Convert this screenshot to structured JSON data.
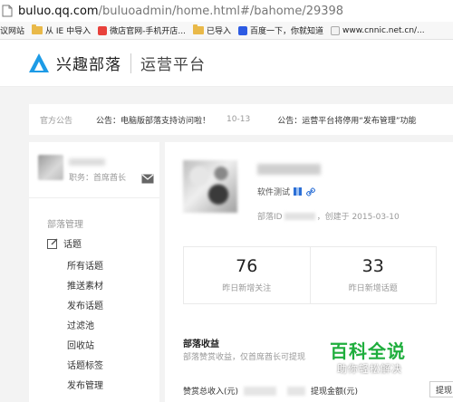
{
  "browser": {
    "url_host": "buluo.qq.com",
    "url_path": "/buluoadmin/home.html#/bahome/29398",
    "bookmarks": [
      {
        "label": "议网站",
        "icon": "none"
      },
      {
        "label": "从 IE 中导入",
        "icon": "folder-icon"
      },
      {
        "label": "微店官网-手机开店...",
        "icon": "weidian-icon"
      },
      {
        "label": "已导入",
        "icon": "folder-icon"
      },
      {
        "label": "百度一下，你就知道",
        "icon": "baidu-icon"
      },
      {
        "label": "www.cnnic.net.cn/...",
        "icon": "cnnic-icon"
      }
    ]
  },
  "header": {
    "brand": "兴趣部落",
    "platform": "运营平台"
  },
  "notice": {
    "label": "官方公告",
    "item1": "公告：电脑版部落支持访问啦！",
    "date1": "10-13",
    "item2": "公告：运营平台将停用“发布管理”功能"
  },
  "sidebar": {
    "role": "职务：首席酋长",
    "group_label": "部落管理",
    "topic_label": "话题",
    "sub_items": [
      "所有话题",
      "推送素材",
      "发布话题",
      "过滤池",
      "回收站",
      "话题标签",
      "发布管理"
    ]
  },
  "main": {
    "category": "软件测试",
    "meta_prefix": "部落ID",
    "meta_created": "，创建于 2015-03-10",
    "stats": [
      {
        "value": "76",
        "label": "昨日新增关注"
      },
      {
        "value": "33",
        "label": "昨日新增话题"
      }
    ],
    "revenue_title": "部落收益",
    "revenue_desc": "部落赞赏收益，仅首席酋长可提现",
    "total_income_label": "赞赏总收入(元)",
    "withdraw_amount_label": "提现金额(元)",
    "withdraw_button": "提现"
  },
  "watermark": {
    "big": "百科全说",
    "small": "助你轻松解决"
  },
  "colors": {
    "logo_blue": "#1d9be6",
    "watermark_green": "#1fae3d",
    "link_blue": "#2b6fd6"
  }
}
